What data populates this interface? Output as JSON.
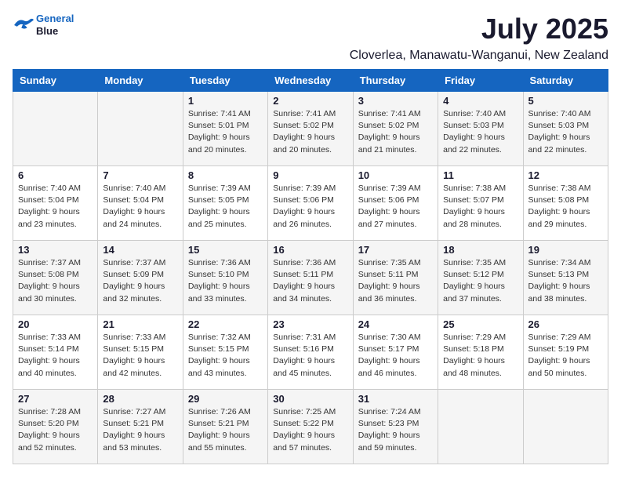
{
  "header": {
    "logo_line1": "General",
    "logo_line2": "Blue",
    "month": "July 2025",
    "location": "Cloverlea, Manawatu-Wanganui, New Zealand"
  },
  "days_of_week": [
    "Sunday",
    "Monday",
    "Tuesday",
    "Wednesday",
    "Thursday",
    "Friday",
    "Saturday"
  ],
  "weeks": [
    [
      {
        "day": "",
        "info": ""
      },
      {
        "day": "",
        "info": ""
      },
      {
        "day": "1",
        "info": "Sunrise: 7:41 AM\nSunset: 5:01 PM\nDaylight: 9 hours and 20 minutes."
      },
      {
        "day": "2",
        "info": "Sunrise: 7:41 AM\nSunset: 5:02 PM\nDaylight: 9 hours and 20 minutes."
      },
      {
        "day": "3",
        "info": "Sunrise: 7:41 AM\nSunset: 5:02 PM\nDaylight: 9 hours and 21 minutes."
      },
      {
        "day": "4",
        "info": "Sunrise: 7:40 AM\nSunset: 5:03 PM\nDaylight: 9 hours and 22 minutes."
      },
      {
        "day": "5",
        "info": "Sunrise: 7:40 AM\nSunset: 5:03 PM\nDaylight: 9 hours and 22 minutes."
      }
    ],
    [
      {
        "day": "6",
        "info": "Sunrise: 7:40 AM\nSunset: 5:04 PM\nDaylight: 9 hours and 23 minutes."
      },
      {
        "day": "7",
        "info": "Sunrise: 7:40 AM\nSunset: 5:04 PM\nDaylight: 9 hours and 24 minutes."
      },
      {
        "day": "8",
        "info": "Sunrise: 7:39 AM\nSunset: 5:05 PM\nDaylight: 9 hours and 25 minutes."
      },
      {
        "day": "9",
        "info": "Sunrise: 7:39 AM\nSunset: 5:06 PM\nDaylight: 9 hours and 26 minutes."
      },
      {
        "day": "10",
        "info": "Sunrise: 7:39 AM\nSunset: 5:06 PM\nDaylight: 9 hours and 27 minutes."
      },
      {
        "day": "11",
        "info": "Sunrise: 7:38 AM\nSunset: 5:07 PM\nDaylight: 9 hours and 28 minutes."
      },
      {
        "day": "12",
        "info": "Sunrise: 7:38 AM\nSunset: 5:08 PM\nDaylight: 9 hours and 29 minutes."
      }
    ],
    [
      {
        "day": "13",
        "info": "Sunrise: 7:37 AM\nSunset: 5:08 PM\nDaylight: 9 hours and 30 minutes."
      },
      {
        "day": "14",
        "info": "Sunrise: 7:37 AM\nSunset: 5:09 PM\nDaylight: 9 hours and 32 minutes."
      },
      {
        "day": "15",
        "info": "Sunrise: 7:36 AM\nSunset: 5:10 PM\nDaylight: 9 hours and 33 minutes."
      },
      {
        "day": "16",
        "info": "Sunrise: 7:36 AM\nSunset: 5:11 PM\nDaylight: 9 hours and 34 minutes."
      },
      {
        "day": "17",
        "info": "Sunrise: 7:35 AM\nSunset: 5:11 PM\nDaylight: 9 hours and 36 minutes."
      },
      {
        "day": "18",
        "info": "Sunrise: 7:35 AM\nSunset: 5:12 PM\nDaylight: 9 hours and 37 minutes."
      },
      {
        "day": "19",
        "info": "Sunrise: 7:34 AM\nSunset: 5:13 PM\nDaylight: 9 hours and 38 minutes."
      }
    ],
    [
      {
        "day": "20",
        "info": "Sunrise: 7:33 AM\nSunset: 5:14 PM\nDaylight: 9 hours and 40 minutes."
      },
      {
        "day": "21",
        "info": "Sunrise: 7:33 AM\nSunset: 5:15 PM\nDaylight: 9 hours and 42 minutes."
      },
      {
        "day": "22",
        "info": "Sunrise: 7:32 AM\nSunset: 5:15 PM\nDaylight: 9 hours and 43 minutes."
      },
      {
        "day": "23",
        "info": "Sunrise: 7:31 AM\nSunset: 5:16 PM\nDaylight: 9 hours and 45 minutes."
      },
      {
        "day": "24",
        "info": "Sunrise: 7:30 AM\nSunset: 5:17 PM\nDaylight: 9 hours and 46 minutes."
      },
      {
        "day": "25",
        "info": "Sunrise: 7:29 AM\nSunset: 5:18 PM\nDaylight: 9 hours and 48 minutes."
      },
      {
        "day": "26",
        "info": "Sunrise: 7:29 AM\nSunset: 5:19 PM\nDaylight: 9 hours and 50 minutes."
      }
    ],
    [
      {
        "day": "27",
        "info": "Sunrise: 7:28 AM\nSunset: 5:20 PM\nDaylight: 9 hours and 52 minutes."
      },
      {
        "day": "28",
        "info": "Sunrise: 7:27 AM\nSunset: 5:21 PM\nDaylight: 9 hours and 53 minutes."
      },
      {
        "day": "29",
        "info": "Sunrise: 7:26 AM\nSunset: 5:21 PM\nDaylight: 9 hours and 55 minutes."
      },
      {
        "day": "30",
        "info": "Sunrise: 7:25 AM\nSunset: 5:22 PM\nDaylight: 9 hours and 57 minutes."
      },
      {
        "day": "31",
        "info": "Sunrise: 7:24 AM\nSunset: 5:23 PM\nDaylight: 9 hours and 59 minutes."
      },
      {
        "day": "",
        "info": ""
      },
      {
        "day": "",
        "info": ""
      }
    ]
  ]
}
